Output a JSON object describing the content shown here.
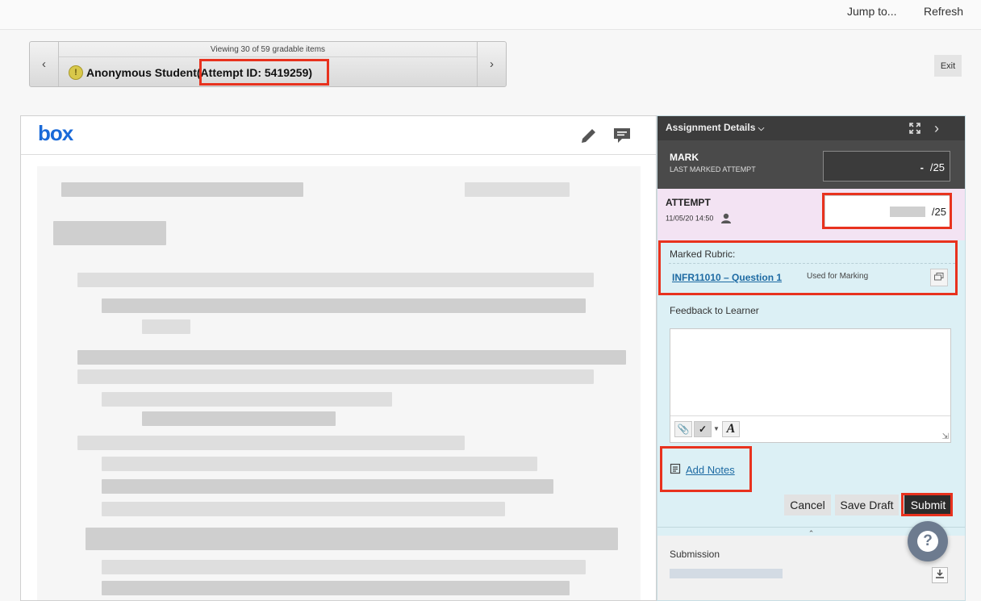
{
  "topbar": {
    "jump_label": "Jump to...",
    "refresh_label": "Refresh"
  },
  "navigator": {
    "viewing_text": "Viewing 30 of 59 gradable items",
    "student_name": "Anonymous Student",
    "attempt_id": "(Attempt ID: 5419259)"
  },
  "exit_label": "Exit",
  "viewer": {
    "logo_text": "box"
  },
  "panel": {
    "title": "Assignment Details",
    "mark": {
      "title": "MARK",
      "subtitle": "LAST MARKED ATTEMPT",
      "value": "-",
      "max": "/25"
    },
    "attempt": {
      "title": "ATTEMPT",
      "date": "11/05/20 14:50",
      "max": "/25"
    },
    "rubric": {
      "label": "Marked Rubric:",
      "link": "INFR11010 – Question 1",
      "note": "Used for Marking"
    },
    "feedback_label": "Feedback to Learner",
    "add_notes": "Add Notes",
    "buttons": {
      "cancel": "Cancel",
      "save_draft": "Save Draft",
      "submit": "Submit"
    },
    "submission_label": "Submission"
  },
  "colors": {
    "highlight": "#e8321e",
    "link": "#1d6aa3",
    "panel_bg": "#dcf0f5",
    "attempt_bg": "#f3e3f3"
  }
}
